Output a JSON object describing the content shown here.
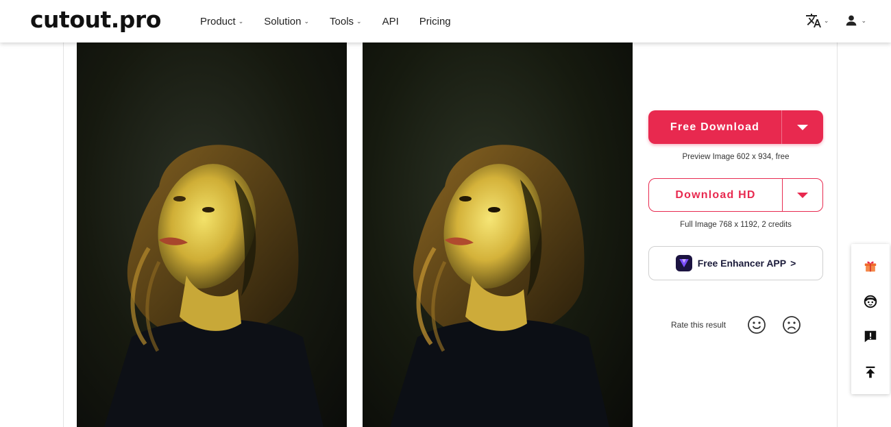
{
  "header": {
    "logo": "cutout.pro",
    "nav": [
      {
        "label": "Product",
        "has_dropdown": true
      },
      {
        "label": "Solution",
        "has_dropdown": true
      },
      {
        "label": "Tools",
        "has_dropdown": true
      },
      {
        "label": "API",
        "has_dropdown": false
      },
      {
        "label": "Pricing",
        "has_dropdown": false
      }
    ],
    "right_icons": [
      "translate-icon",
      "user-icon"
    ]
  },
  "images": {
    "original": "original-portrait-photo",
    "enhanced": "enhanced-portrait-photo"
  },
  "panel": {
    "free_download": {
      "label": "Free Download",
      "caption": "Preview Image 602 x 934, free"
    },
    "download_hd": {
      "label": "Download HD",
      "caption": "Full Image 768 x 1192, 2 credits"
    },
    "app_button": {
      "label": "Free Enhancer APP",
      "arrow": ">"
    },
    "rate_label": "Rate this result"
  },
  "side_toolbar": [
    "gift-icon",
    "face-support-icon",
    "feedback-icon",
    "back-to-top-icon"
  ],
  "colors": {
    "accent": "#e8294f",
    "app_logo_bg": "#1b1340",
    "app_logo_accent": "#7b4dff"
  }
}
